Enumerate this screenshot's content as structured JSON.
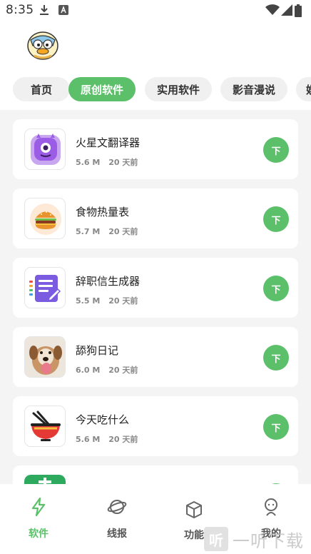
{
  "status_bar": {
    "time": "8:35",
    "icons": [
      "download-icon",
      "a-icon",
      "wifi-icon",
      "signal-icon",
      "battery-icon"
    ]
  },
  "header": {
    "avatar": "duck-avatar"
  },
  "tabs": [
    {
      "label": "首页",
      "active": false
    },
    {
      "label": "原创软件",
      "active": true
    },
    {
      "label": "实用软件",
      "active": false
    },
    {
      "label": "影音漫说",
      "active": false
    },
    {
      "label": "娱",
      "active": false
    }
  ],
  "apps": [
    {
      "name": "火星文翻译器",
      "size": "5.6 M",
      "time": "20 天前",
      "button": "下",
      "icon": "purple-monster-icon"
    },
    {
      "name": "食物热量表",
      "size": "5.7 M",
      "time": "20 天前",
      "button": "下",
      "icon": "burger-icon"
    },
    {
      "name": "辞职信生成器",
      "size": "5.5 M",
      "time": "20 天前",
      "button": "下",
      "icon": "document-pen-icon"
    },
    {
      "name": "舔狗日记",
      "size": "6.0 M",
      "time": "20 天前",
      "button": "下",
      "icon": "dog-photo-icon"
    },
    {
      "name": "今天吃什么",
      "size": "5.6 M",
      "time": "20 天前",
      "button": "下",
      "icon": "noodle-bowl-icon"
    },
    {
      "name": "",
      "size": "",
      "time": "",
      "button": "",
      "icon": "green-app-icon"
    }
  ],
  "bottom_nav": [
    {
      "label": "软件",
      "icon": "lightning-icon",
      "active": true
    },
    {
      "label": "线报",
      "icon": "planet-icon",
      "active": false
    },
    {
      "label": "功能",
      "icon": "cube-icon",
      "active": false
    },
    {
      "label": "我的",
      "icon": "profile-icon",
      "active": false
    }
  ],
  "watermark": {
    "logo": "听",
    "text": "一听下载"
  },
  "colors": {
    "accent": "#5cbf6a",
    "background": "#f4f4f4",
    "card": "#ffffff"
  }
}
